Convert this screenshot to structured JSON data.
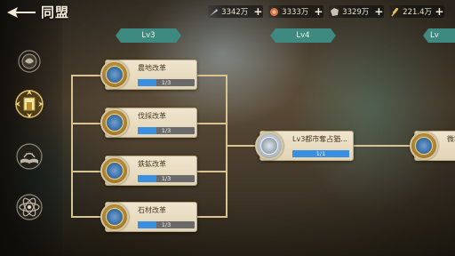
{
  "header": {
    "title": "同盟",
    "resources": [
      {
        "icon": "feather-icon",
        "value": "3342万"
      },
      {
        "icon": "food-icon",
        "value": "3333万"
      },
      {
        "icon": "ore-icon",
        "value": "3329万"
      },
      {
        "icon": "wheat-icon",
        "value": "221.4万"
      }
    ]
  },
  "levels": [
    "Lv3",
    "Lv4",
    "Lv"
  ],
  "side_tabs": [
    {
      "icon": "alliance-emblem-icon"
    },
    {
      "icon": "tower-shield-icon"
    },
    {
      "icon": "book-icon"
    },
    {
      "icon": "atom-icon"
    }
  ],
  "techs_lv3": [
    {
      "name": "農地改革",
      "progress": "1/3",
      "ratio": 0.3333
    },
    {
      "name": "伐採改革",
      "progress": "1/3",
      "ratio": 0.3333
    },
    {
      "name": "鉄鉱改革",
      "progress": "1/3",
      "ratio": 0.3333
    },
    {
      "name": "石材改革",
      "progress": "1/3",
      "ratio": 0.3333
    }
  ],
  "tech_lv4": {
    "name": "Lv3都市奪占猶...",
    "progress": "1/1",
    "ratio": 1
  },
  "tech_lv5": {
    "name": "微积",
    "progress": "",
    "ratio": 0
  },
  "colors": {
    "banner": "#3f8a80",
    "bar_fill": "#3b8fe0",
    "line": "#d9c38f"
  }
}
